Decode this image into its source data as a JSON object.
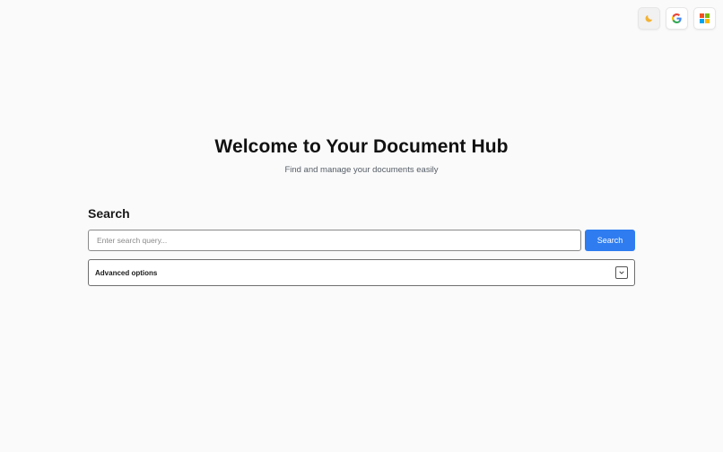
{
  "header": {
    "actions": [
      {
        "id": "theme",
        "icon": "moon-icon"
      },
      {
        "id": "google",
        "icon": "google-icon"
      },
      {
        "id": "microsoft",
        "icon": "microsoft-icon"
      }
    ]
  },
  "hero": {
    "title": "Welcome to Your Document Hub",
    "subtitle": "Find and manage your documents easily"
  },
  "search": {
    "heading": "Search",
    "placeholder": "Enter search query...",
    "value": "",
    "button_label": "Search",
    "button_color": "#2e7cf0"
  },
  "advanced": {
    "label": "Advanced options",
    "expanded": false,
    "toggle_icon": "chevron-down-icon"
  }
}
